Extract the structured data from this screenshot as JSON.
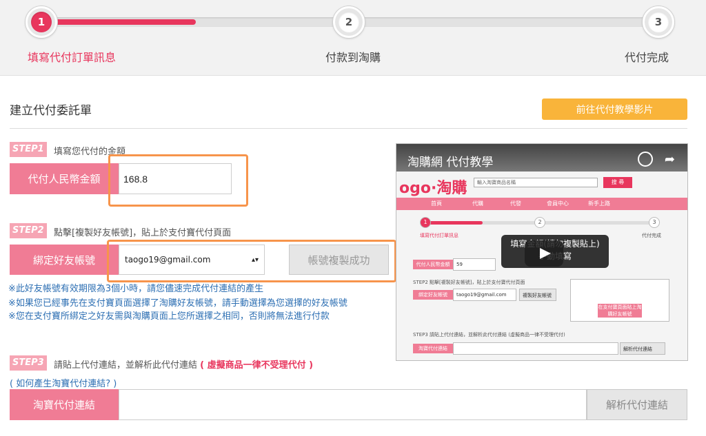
{
  "progress": {
    "steps": [
      {
        "num": "1",
        "label": "填寫代付訂單訊息",
        "active": true
      },
      {
        "num": "2",
        "label": "付款到淘購",
        "active": false
      },
      {
        "num": "3",
        "label": "代付完成",
        "active": false
      }
    ],
    "completion": 0.25
  },
  "header": {
    "title": "建立代付委託單",
    "video_button": "前往代付教學影片"
  },
  "step1": {
    "badge": "STEP1",
    "text": "填寫您代付的金額",
    "label": "代付人民幣金額",
    "amount": "168.8"
  },
  "step2": {
    "badge": "STEP2",
    "text": "點擊[複製好友帳號]，貼上於支付寶代付頁面",
    "label": "綁定好友帳號",
    "account": "taogo19@gmail.com",
    "copy_button": "帳號複製成功",
    "notes": [
      "※此好友帳號有效期限為3個小時，請您儘速完成代付連結的產生",
      "※如果您已經事先在支付寶頁面選擇了淘購好友帳號，請手動選擇為您選擇的好友帳號",
      "※您在支付寶所綁定之好友需與淘購頁面上您所選擇之相同，否則將無法進行付款"
    ]
  },
  "step3": {
    "badge": "STEP3",
    "text": "請貼上代付連結，並解析此代付連結",
    "warning": "( 虛擬商品一律不受理代付 )",
    "howto_link": "( 如何產生淘寶代付連結? )",
    "label": "淘寶代付連結",
    "parse_button": "解析代付連結"
  },
  "video": {
    "title": "淘購網 代付教學",
    "logo": "ogo·淘購",
    "search_placeholder": "輸入淘寶商品名稱",
    "search_button": "搜 尋",
    "nav": [
      "首頁",
      "代購",
      "代發",
      "會員中心",
      "新手上路"
    ],
    "steps": [
      "1",
      "2",
      "3"
    ],
    "step1_label": "填寫代付訂單訊息",
    "step3_label": "代付完成",
    "callout": "填寫金額(請勿複製貼上)\n手動填寫",
    "amount_label": "代付人民幣金額",
    "amount_value": "59",
    "step2_text": "STEP2 點擊[複製好友帳號]，貼上於支付寶代付頁面",
    "account_label": "綁定好友帳號",
    "account_value": "taogo19@gmail.com",
    "copy_label": "複製好友帳號",
    "confirm_label": "在支付寶頁面貼上淘購好友帳號",
    "step3_text": "STEP3 請貼上代付連結，並解析此代付連結 (虛擬商品一律不受理代付)",
    "link_label": "淘寶代付連結",
    "parse_label": "解析代付連結"
  },
  "colors": {
    "accent": "#e8365d",
    "pink_label": "#f07c95",
    "badge": "#f6a5b4",
    "orange_button": "#f9b43a",
    "highlight": "#f7944b",
    "link": "#2d6fb3"
  }
}
